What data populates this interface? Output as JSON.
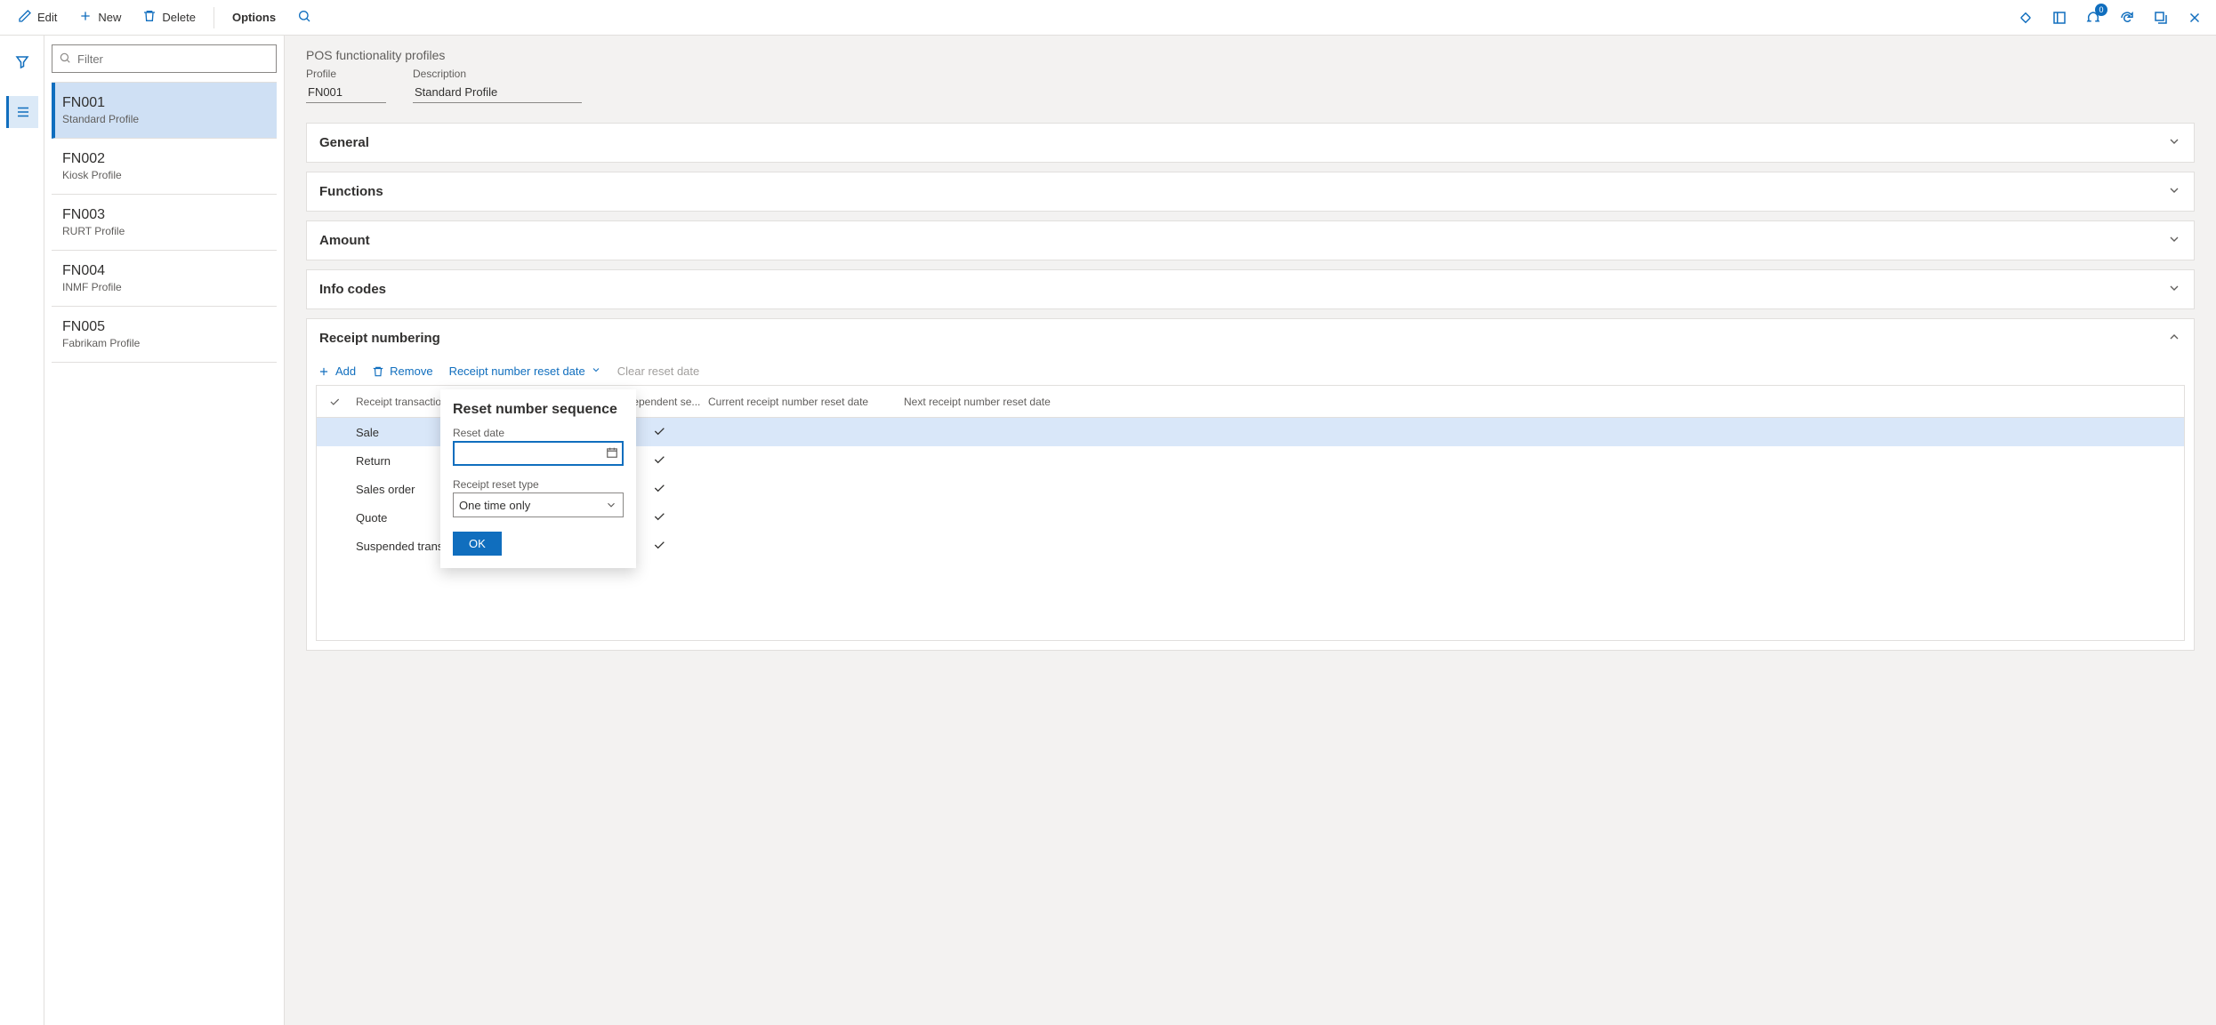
{
  "topbar": {
    "edit": "Edit",
    "new": "New",
    "delete": "Delete",
    "options": "Options",
    "badge": "0"
  },
  "listpane": {
    "filter_placeholder": "Filter",
    "profiles": [
      {
        "code": "FN001",
        "desc": "Standard Profile"
      },
      {
        "code": "FN002",
        "desc": "Kiosk Profile"
      },
      {
        "code": "FN003",
        "desc": "RURT Profile"
      },
      {
        "code": "FN004",
        "desc": "INMF Profile"
      },
      {
        "code": "FN005",
        "desc": "Fabrikam Profile"
      }
    ]
  },
  "content": {
    "page_title": "POS functionality profiles",
    "profile_label": "Profile",
    "profile_value": "FN001",
    "desc_label": "Description",
    "desc_value": "Standard Profile",
    "fasttabs": {
      "general": "General",
      "functions": "Functions",
      "amount": "Amount",
      "infocodes": "Info codes",
      "receipt_numbering": "Receipt numbering"
    },
    "grid": {
      "actions": {
        "add": "Add",
        "remove": "Remove",
        "reset_date": "Receipt number reset date",
        "clear_reset": "Clear reset date"
      },
      "columns": {
        "type": "Receipt transaction t...",
        "independent": "Independent se...",
        "current": "Current receipt number reset date",
        "next": "Next receipt number reset date"
      },
      "rows": [
        {
          "type": "Sale",
          "independent": true
        },
        {
          "type": "Return",
          "independent": true
        },
        {
          "type": "Sales order",
          "independent": true
        },
        {
          "type": "Quote",
          "independent": true
        },
        {
          "type": "Suspended transa…",
          "independent": true
        }
      ]
    },
    "popup": {
      "title": "Reset number sequence",
      "reset_date_label": "Reset date",
      "reset_date_value": "",
      "reset_type_label": "Receipt reset type",
      "reset_type_value": "One time only",
      "ok": "OK"
    }
  }
}
